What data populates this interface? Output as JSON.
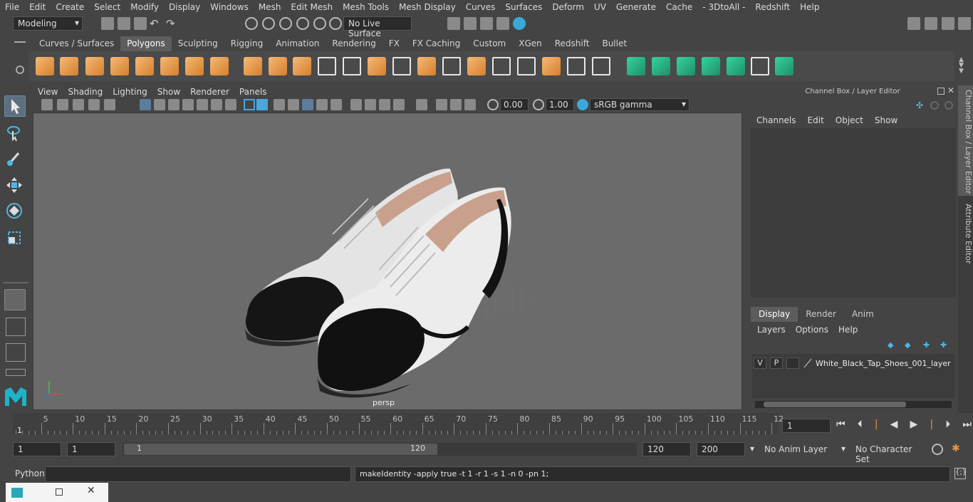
{
  "menubar": [
    "File",
    "Edit",
    "Create",
    "Select",
    "Modify",
    "Display",
    "Windows",
    "Mesh",
    "Edit Mesh",
    "Mesh Tools",
    "Mesh Display",
    "Curves",
    "Surfaces",
    "Deform",
    "UV",
    "Generate",
    "Cache",
    "- 3DtoAll -",
    "Redshift",
    "Help"
  ],
  "status": {
    "mode": "Modeling",
    "live_surface": "No Live Surface"
  },
  "shelf_tabs": [
    "Curves / Surfaces",
    "Polygons",
    "Sculpting",
    "Rigging",
    "Animation",
    "Rendering",
    "FX",
    "FX Caching",
    "Custom",
    "XGen",
    "Redshift",
    "Bullet"
  ],
  "shelf_active": "Polygons",
  "viewport": {
    "menu": [
      "View",
      "Shading",
      "Lighting",
      "Show",
      "Renderer",
      "Panels"
    ],
    "exposure": "0.00",
    "gamma": "1.00",
    "colorspace": "sRGB gamma",
    "camera": "persp"
  },
  "channel_box": {
    "title": "Channel Box / Layer Editor",
    "menu": [
      "Channels",
      "Edit",
      "Object",
      "Show"
    ]
  },
  "layer_editor": {
    "tabs": [
      "Display",
      "Render",
      "Anim"
    ],
    "active_tab": "Display",
    "menu": [
      "Layers",
      "Options",
      "Help"
    ],
    "layer": {
      "v": "V",
      "p": "P",
      "name": "White_Black_Tap_Shoes_001_layer"
    }
  },
  "side_tabs": [
    "Channel Box / Layer Editor",
    "Attribute Editor"
  ],
  "timeline": {
    "ticks": [
      "5",
      "10",
      "15",
      "20",
      "25",
      "30",
      "35",
      "40",
      "45",
      "50",
      "55",
      "60",
      "65",
      "70",
      "75",
      "80",
      "85",
      "90",
      "95",
      "100",
      "105",
      "110",
      "115",
      "12"
    ],
    "start_marker": "1",
    "current_frame": "1"
  },
  "range": {
    "start": "1",
    "playback_start": "1",
    "slider_start": "1",
    "slider_end": "120",
    "playback_end": "120",
    "end": "200",
    "anim_layer": "No Anim Layer",
    "character_set": "No Character Set"
  },
  "command": {
    "lang": "Python",
    "output": "makeIdentity -apply true -t 1 -r 1 -s 1 -n 0 -pn 1;"
  }
}
